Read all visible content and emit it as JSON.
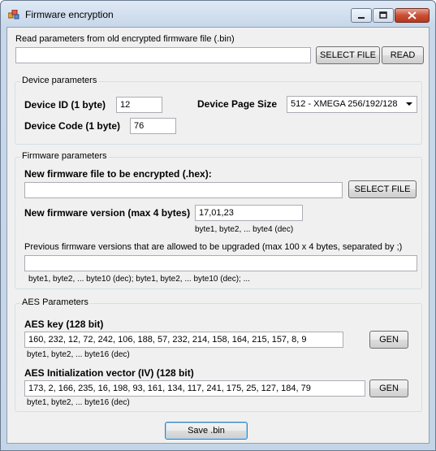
{
  "window": {
    "title": "Firmware encryption"
  },
  "read_section": {
    "label": "Read parameters from old encrypted firmware file (.bin)",
    "file_path": "",
    "select_file_label": "SELECT FILE",
    "read_label": "READ"
  },
  "device": {
    "group_title": "Device parameters",
    "id_label": "Device ID (1 byte)",
    "id_value": "12",
    "code_label": "Device Code (1 byte)",
    "code_value": "76",
    "page_size_label": "Device Page Size",
    "page_size_value": "512 - XMEGA 256/192/128"
  },
  "firmware": {
    "group_title": "Firmware parameters",
    "new_file_label": "New firmware file to be encrypted (.hex):",
    "new_file_path": "",
    "select_file_label": "SELECT FILE",
    "version_label": "New firmware version (max 4 bytes)",
    "version_value": "17,01,23",
    "version_hint": "byte1, byte2, ... byte4 (dec)",
    "prev_label": "Previous firmware versions that are allowed to be upgraded (max 100 x 4 bytes, separated by ;)",
    "prev_value": "",
    "prev_hint": "byte1, byte2, ... byte10 (dec); byte1, byte2, ... byte10 (dec); ..."
  },
  "aes": {
    "group_title": "AES Parameters",
    "key_label": "AES key (128 bit)",
    "key_value": "160, 232, 12, 72, 242, 106, 188, 57, 232, 214, 158, 164, 215, 157, 8, 9",
    "key_hint": "byte1, byte2, ... byte16 (dec)",
    "key_gen_label": "GEN",
    "iv_label": "AES Initialization vector (IV) (128 bit)",
    "iv_value": "173, 2, 166, 235, 16, 198, 93, 161, 134, 117, 241, 175, 25, 127, 184, 79",
    "iv_hint": "byte1, byte2, ... byte16 (dec)",
    "iv_gen_label": "GEN"
  },
  "save_label": "Save .bin"
}
